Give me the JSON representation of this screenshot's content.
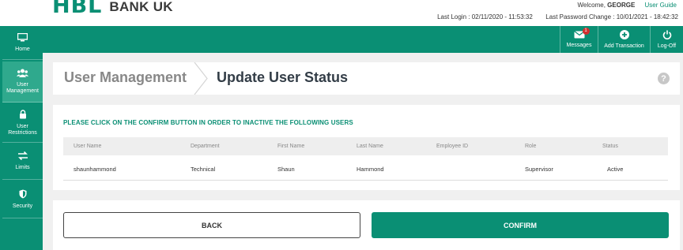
{
  "header": {
    "logo_mark": "HBL",
    "logo_text": "BANK UK",
    "welcome_prefix": "Welcome,",
    "username": "GEORGE",
    "user_guide": "User Guide",
    "last_login_label": "Last Login :",
    "last_login_value": "02/11/2020 - 11:53:32",
    "last_pw_label": "Last Password Change :",
    "last_pw_value": "10/01/2021 - 18:42:32"
  },
  "topnav": {
    "messages_label": "Messages",
    "messages_count": "1",
    "add_transaction_label": "Add Transaction",
    "logoff_label": "Log-Off"
  },
  "sidebar": {
    "items": [
      {
        "label": "Home",
        "icon": "monitor-icon"
      },
      {
        "label": "User Management",
        "icon": "users-icon"
      },
      {
        "label": "User Restrictions",
        "icon": "lock-icon"
      },
      {
        "label": "Limits",
        "icon": "exchange-icon"
      },
      {
        "label": "Security",
        "icon": "shield-icon"
      }
    ]
  },
  "page": {
    "breadcrumb_parent": "User Management",
    "breadcrumb_current": "Update User Status",
    "help_glyph": "?"
  },
  "notice": "PLEASE CLICK ON THE CONFIRM BUTTON IN ORDER TO INACTIVE THE FOLLOWING USERS",
  "table": {
    "columns": [
      "User Name",
      "Department",
      "First Name",
      "Last Name",
      "Employee ID",
      "Role",
      "Status"
    ],
    "rows": [
      [
        "shaunhammond",
        "Technical",
        "Shaun",
        "Hammond",
        "",
        "Supervisor",
        "Active"
      ]
    ]
  },
  "actions": {
    "back_label": "BACK",
    "confirm_label": "CONFIRM"
  },
  "colors": {
    "brand": "#0a8f74",
    "badge": "#d32f2f"
  }
}
